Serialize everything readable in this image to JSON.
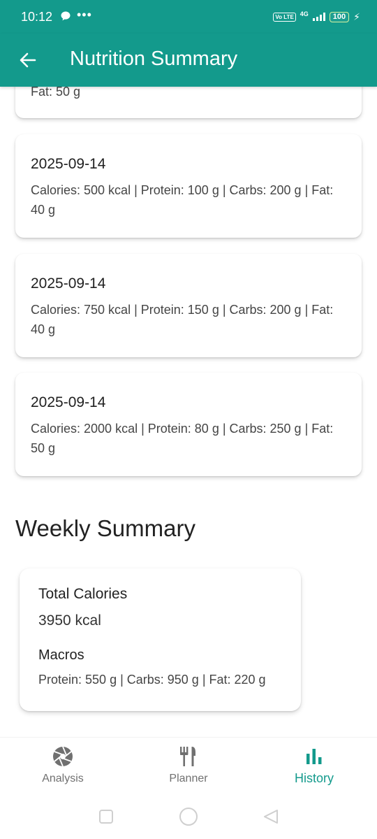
{
  "status_bar": {
    "time": "10:12",
    "dots": "•••",
    "volte": "Vo LTE",
    "network": "4G",
    "battery": "100",
    "bolt": "⚡"
  },
  "app_bar": {
    "title": "Nutrition Summary"
  },
  "partial_entry": {
    "detail": "Fat: 50 g"
  },
  "entries": [
    {
      "date": "2025-09-14",
      "detail": "Calories: 500 kcal | Protein: 100 g | Carbs: 200 g | Fat: 40 g"
    },
    {
      "date": "2025-09-14",
      "detail": "Calories: 750 kcal | Protein: 150 g | Carbs: 200 g | Fat: 40 g"
    },
    {
      "date": "2025-09-14",
      "detail": "Calories: 2000 kcal | Protein: 80 g | Carbs: 250 g | Fat: 50 g"
    }
  ],
  "weekly": {
    "title": "Weekly Summary",
    "total_label": "Total Calories",
    "total_value": "3950 kcal",
    "macros_label": "Macros",
    "macros_value": "Protein: 550 g | Carbs: 950 g | Fat: 220 g"
  },
  "bottom_nav": {
    "items": [
      {
        "label": "Analysis",
        "icon": "camera-shutter-icon"
      },
      {
        "label": "Planner",
        "icon": "fork-knife-icon"
      },
      {
        "label": "History",
        "icon": "bar-chart-icon",
        "active": true
      }
    ]
  },
  "colors": {
    "primary": "#139a8c",
    "text_secondary": "#454545",
    "nav_inactive": "#707070"
  }
}
